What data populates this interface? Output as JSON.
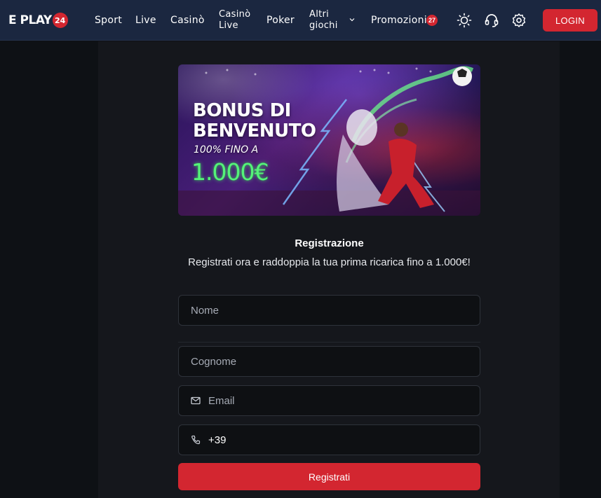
{
  "logo": {
    "text": "E PLAY",
    "badge": "24"
  },
  "nav": {
    "sport": "Sport",
    "live": "Live",
    "casino": "Casinò",
    "casino_live_1": "Casinò",
    "casino_live_2": "Live",
    "poker": "Poker",
    "altri_1": "Altri",
    "altri_2": "giochi",
    "promozioni": "Promozioni",
    "promo_count": "27"
  },
  "header_icons": [
    "sun-icon",
    "headset-icon",
    "gear-icon"
  ],
  "login_label": "LOGIN",
  "banner": {
    "title_line1": "BONUS DI",
    "title_line2": "BENVENUTO",
    "subtitle": "100% FINO A",
    "amount": "1.000€"
  },
  "registration": {
    "title": "Registrazione",
    "subtitle": "Registrati ora e raddoppia la tua prima ricarica fino a 1.000€!",
    "name_placeholder": "Nome",
    "surname_placeholder": "Cognome",
    "email_placeholder": "Email",
    "phone_prefix": "+39",
    "submit_label": "Registrati"
  },
  "colors": {
    "brand_red": "#d32630",
    "header_bg": "#1b2740",
    "page_bg": "#0e1115",
    "accent_green": "#55f27a"
  }
}
